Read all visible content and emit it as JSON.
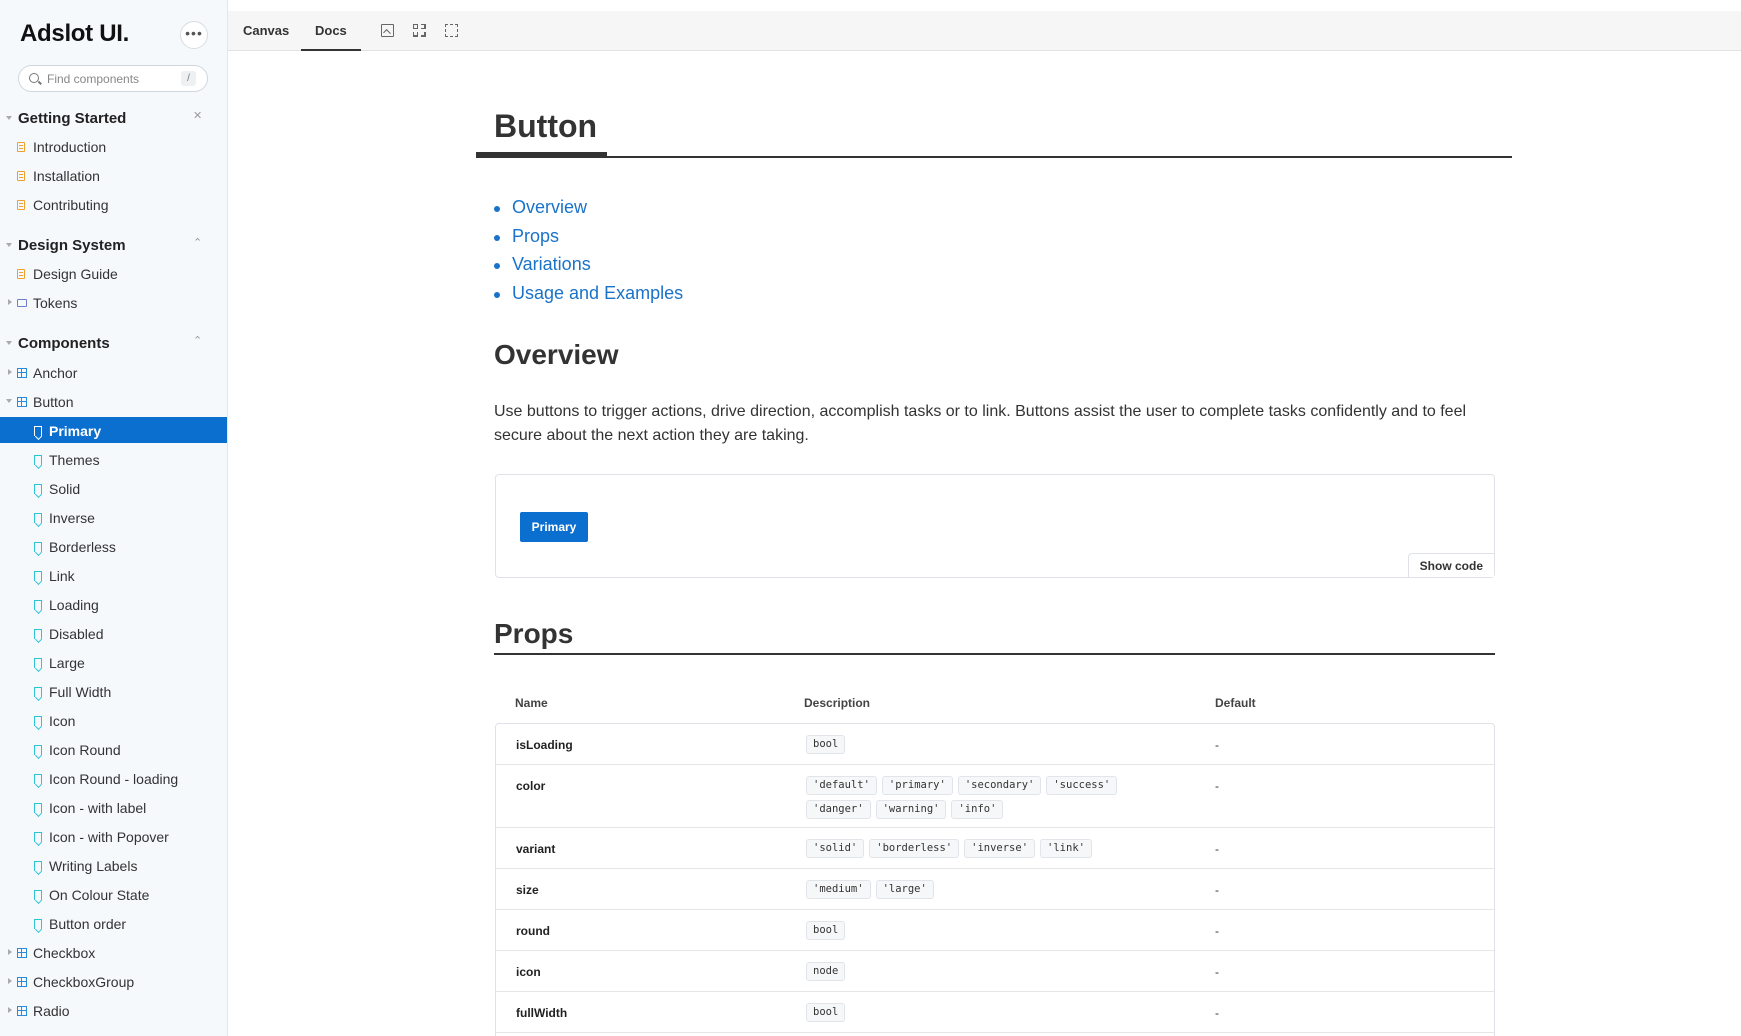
{
  "app": {
    "brand": "Adslot UI.",
    "search_placeholder": "Find components",
    "search_shortcut": "/"
  },
  "sidebar": {
    "getting_started": {
      "title": "Getting Started",
      "items": [
        "Introduction",
        "Installation",
        "Contributing"
      ]
    },
    "design_system": {
      "title": "Design System",
      "items": [
        "Design Guide",
        "Tokens"
      ]
    },
    "components": {
      "title": "Components",
      "items": [
        "Anchor",
        "Button",
        "Checkbox",
        "CheckboxGroup",
        "Radio"
      ],
      "button_stories": [
        "Primary",
        "Themes",
        "Solid",
        "Inverse",
        "Borderless",
        "Link",
        "Loading",
        "Disabled",
        "Large",
        "Full Width",
        "Icon",
        "Icon Round",
        "Icon Round - loading",
        "Icon - with label",
        "Icon - with Popover",
        "Writing Labels",
        "On Colour State",
        "Button order"
      ],
      "active_story": "Primary"
    }
  },
  "toolbar": {
    "tabs": [
      "Canvas",
      "Docs"
    ],
    "active_tab": "Docs",
    "icons": [
      "image-icon",
      "grid-icon",
      "outline-icon"
    ]
  },
  "page": {
    "title": "Button",
    "toc": [
      "Overview",
      "Props",
      "Variations",
      "Usage and Examples"
    ],
    "overview": {
      "heading": "Overview",
      "text": "Use buttons to trigger actions, drive direction, accomplish tasks or to link. Buttons assist the user to complete tasks confidently and to feel secure about the next action they are taking."
    },
    "preview": {
      "button_label": "Primary",
      "show_code": "Show code"
    },
    "props": {
      "heading": "Props",
      "columns": [
        "Name",
        "Description",
        "Default"
      ],
      "rows": [
        {
          "name": "isLoading",
          "values": [
            "bool"
          ],
          "default": "-"
        },
        {
          "name": "color",
          "values": [
            "'default'",
            "'primary'",
            "'secondary'",
            "'success'",
            "'danger'",
            "'warning'",
            "'info'"
          ],
          "default": "-"
        },
        {
          "name": "variant",
          "values": [
            "'solid'",
            "'borderless'",
            "'inverse'",
            "'link'"
          ],
          "default": "-"
        },
        {
          "name": "size",
          "values": [
            "'medium'",
            "'large'"
          ],
          "default": "-"
        },
        {
          "name": "round",
          "values": [
            "bool"
          ],
          "default": "-"
        },
        {
          "name": "icon",
          "values": [
            "node"
          ],
          "default": "-"
        },
        {
          "name": "fullWidth",
          "values": [
            "bool"
          ],
          "default": "-"
        }
      ]
    }
  },
  "colors": {
    "accent": "#0b6fcf",
    "link": "#1a73c8",
    "sidebar_bg": "#f6f9fc"
  }
}
